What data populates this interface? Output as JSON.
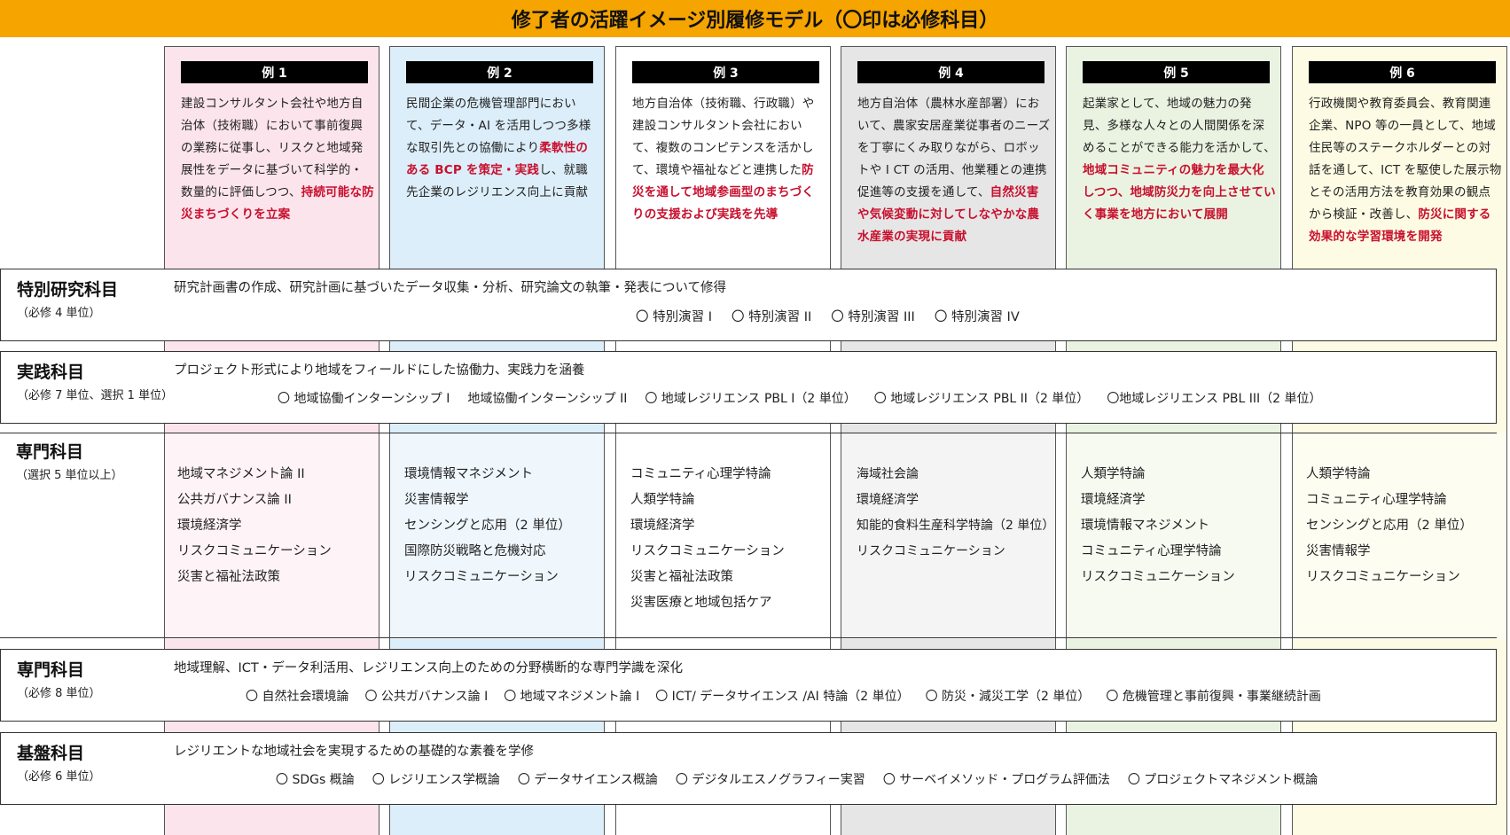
{
  "title": "修了者の活躍イメージ別履修モデル（〇印は必修科目）",
  "columns": [
    {
      "label": "例 1",
      "bg": "#fce4ec",
      "desc_plain": "建設コンサルタント会社や地方自治体（技術職）において事前復興の業務に従事し、リスクと地域発展性をデータに基づいて科学的・数量的に評価しつつ、",
      "desc_hl": "持続可能な防災まちづくりを立案",
      "desc_tail": "",
      "electives": [
        "地域マネジメント論 II",
        "公共ガバナンス論 II",
        "環境経済学",
        "リスクコミュニケーション",
        "災害と福祉法政策"
      ]
    },
    {
      "label": "例 2",
      "bg": "#dceefa",
      "desc_plain": "民間企業の危機管理部門において、データ・AI を活用しつつ多様な取引先との協働により",
      "desc_hl": "柔軟性のある BCP を策定・実践",
      "desc_tail": "し、就職先企業のレジリエンス向上に貢献",
      "electives": [
        "環境情報マネジメント",
        "災害情報学",
        "センシングと応用（2 単位）",
        "国際防災戦略と危機対応",
        "リスクコミュニケーション"
      ]
    },
    {
      "label": "例 3",
      "bg": "#ffffff",
      "desc_plain": "地方自治体（技術職、行政職）や建設コンサルタント会社において、複数のコンピテンスを活かして、環境や福祉などと連携した",
      "desc_hl": "防災を通して地域参画型のまちづくりの支援および実践を先導",
      "desc_tail": "",
      "electives": [
        "コミュニティ心理学特論",
        "人類学特論",
        "環境経済学",
        "リスクコミュニケーション",
        "災害と福祉法政策",
        "災害医療と地域包括ケア"
      ]
    },
    {
      "label": "例 4",
      "bg": "#e6e6e6",
      "desc_plain": "地方自治体（農林水産部署）において、農家安居産業従事者のニーズを丁寧にくみ取りながら、ロボットや I CT の活用、他業種との連携促進等の支援を通して、",
      "desc_hl": "自然災害や気候変動に対してしなやかな農水産業の実現に貢献",
      "desc_tail": "",
      "electives": [
        "海域社会論",
        "環境経済学",
        "知能的食料生産科学特論（2 単位）",
        "リスクコミュニケーション"
      ]
    },
    {
      "label": "例 5",
      "bg": "#eaf3e1",
      "desc_plain": "起業家として、地域の魅力の発見、多様な人々との人間関係を深めることができる能力を活かして、",
      "desc_hl": "地域コミュニティの魅力を最大化しつつ、地域防災力を向上させていく事業を地方において展開",
      "desc_tail": "",
      "electives": [
        "人類学特論",
        "環境経済学",
        "環境情報マネジメント",
        "コミュニティ心理学特論",
        "リスクコミュニケーション"
      ]
    },
    {
      "label": "例 6",
      "bg": "#fdfbe3",
      "desc_plain": "行政機関や教育委員会、教育関連企業、NPO 等の一員として、地域住民等のステークホルダーとの対話を通して、ICT を駆使した展示物とその活用方法を教育効果の観点から検証・改善し、",
      "desc_hl": "防災に関する効果的な学習環境を開発",
      "desc_tail": "",
      "electives": [
        "人類学特論",
        "コミュニティ心理学特論",
        "センシングと応用（2 単位）",
        "災害情報学",
        "リスクコミュニケーション"
      ]
    }
  ],
  "bands": [
    {
      "title": "特別研究科目",
      "sub": "（必修 4 単位）",
      "desc": "研究計画書の作成、研究計画に基づいたデータ収集・分析、研究論文の執筆・発表について修得",
      "items": [
        "〇 特別演習 I",
        "〇 特別演習 II",
        "〇 特別演習 III",
        "〇 特別演習 IV"
      ]
    },
    {
      "title": "実践科目",
      "sub": "（必修 7 単位、選択 1 単位）",
      "desc": "プロジェクト形式により地域をフィールドにした協働力、実践力を涵養",
      "items": [
        "〇 地域協働インターンシップ I",
        "地域協働インターンシップ II",
        "〇 地域レジリエンス PBL I（2 単位）",
        "〇 地域レジリエンス PBL II（2 単位）",
        "〇地域レジリエンス PBL III（2 単位）"
      ]
    },
    {
      "title": "専門科目",
      "sub": "（必修 8 単位）",
      "desc": "地域理解、ICT・データ利活用、レジリエンス向上のための分野横断的な専門学識を深化",
      "items": [
        "〇 自然社会環境論",
        "〇 公共ガバナンス論 I",
        "〇 地域マネジメント論 I",
        "〇 ICT/ データサイエンス /AI 特論（2 単位）",
        "〇 防災・減災工学（2 単位）",
        "〇 危機管理と事前復興・事業継続計画"
      ]
    },
    {
      "title": "基盤科目",
      "sub": "（必修 6 単位）",
      "desc": "レジリエントな地域社会を実現するための基礎的な素養を学修",
      "items": [
        "〇 SDGs 概論",
        "〇 レジリエンス学概論",
        "〇 データサイエンス概論",
        "〇 デジタルエスノグラフィー実習",
        "〇 サーベイメソッド・プログラム評価法",
        "〇 プロジェクトマネジメント概論"
      ]
    }
  ],
  "elective_section": {
    "title": "専門科目",
    "sub": "（選択 5 単位以上）"
  }
}
